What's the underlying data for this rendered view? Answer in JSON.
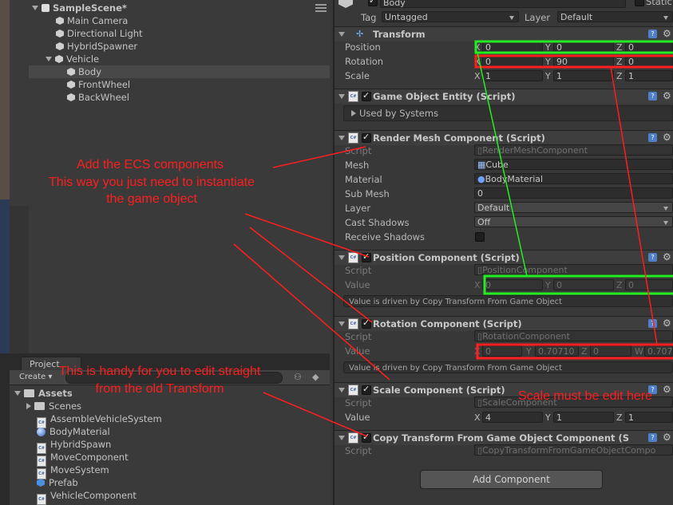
{
  "hierarchy": {
    "scene": "SampleScene*",
    "items": [
      "Main Camera",
      "Directional Light",
      "HybridSpawner"
    ],
    "parent": "Vehicle",
    "children": [
      "Body",
      "FrontWheel",
      "BackWheel"
    ]
  },
  "project": {
    "tab": "Project",
    "create": "Create",
    "assets_label": "Assets",
    "assets": [
      {
        "name": "Scenes",
        "icon": "folder-icon"
      },
      {
        "name": "AssembleVehicleSystem",
        "icon": "script-icon"
      },
      {
        "name": "BodyMaterial",
        "icon": "material-icon"
      },
      {
        "name": "HybridSpawn",
        "icon": "script-icon"
      },
      {
        "name": "MoveComponent",
        "icon": "script-icon"
      },
      {
        "name": "MoveSystem",
        "icon": "script-icon"
      },
      {
        "name": "Prefab",
        "icon": "prefab-icon"
      },
      {
        "name": "VehicleComponent",
        "icon": "script-icon"
      }
    ]
  },
  "inspector": {
    "object_name": "Body",
    "static_label": "Static",
    "tag_label": "Tag",
    "tag_value": "Untagged",
    "layer_label": "Layer",
    "layer_value": "Default",
    "transform": {
      "title": "Transform",
      "position_label": "Position",
      "position": {
        "x": "0",
        "y": "0",
        "z": "0"
      },
      "rotation_label": "Rotation",
      "rotation": {
        "x": "0",
        "y": "90",
        "z": "0"
      },
      "scale_label": "Scale",
      "scale": {
        "x": "1",
        "y": "1",
        "z": "1"
      }
    },
    "goe": {
      "title": "Game Object Entity (Script)",
      "used_by": "Used by Systems"
    },
    "render_mesh": {
      "title": "Render Mesh Component (Script)",
      "script_label": "Script",
      "script": "RenderMeshComponent",
      "mesh_label": "Mesh",
      "mesh": "Cube",
      "material_label": "Material",
      "material": "BodyMaterial",
      "submesh_label": "Sub Mesh",
      "submesh": "0",
      "layer_label": "Layer",
      "layer": "Default",
      "cast_label": "Cast Shadows",
      "cast": "Off",
      "receive_label": "Receive Shadows"
    },
    "position_comp": {
      "title": "Position Component (Script)",
      "script_label": "Script",
      "script": "PositionComponent",
      "value_label": "Value",
      "value": {
        "x": "0",
        "y": "0",
        "z": "0"
      },
      "info": "Value is driven by Copy Transform From Game Object"
    },
    "rotation_comp": {
      "title": "Rotation Component (Script)",
      "script_label": "Script",
      "script": "RotationComponent",
      "value_label": "Value",
      "value": {
        "x": "0",
        "y": "0.70710",
        "z": "0",
        "w": "0.707"
      },
      "info": "Value is driven by Copy Transform From Game Object"
    },
    "scale_comp": {
      "title": "Scale Component (Script)",
      "script_label": "Script",
      "script": "ScaleComponent",
      "value_label": "Value",
      "value": {
        "x": "4",
        "y": "1",
        "z": "1"
      }
    },
    "copy_comp": {
      "title": "Copy Transform From Game Object Component (S",
      "script_label": "Script",
      "script": "CopyTransformFromGameObjectCompo"
    },
    "add_component": "Add Component"
  },
  "annotations": {
    "ecs_line1": "Add the ECS components",
    "ecs_line2": "This way you just need to instantiate",
    "ecs_line3": "the game object",
    "handy_line1": "This is handy for you to edit straight",
    "handy_line2": "from the old Transform",
    "scale_note": "Scale must be edit here",
    "red": "#ff1e1e",
    "green": "#22ee22"
  }
}
